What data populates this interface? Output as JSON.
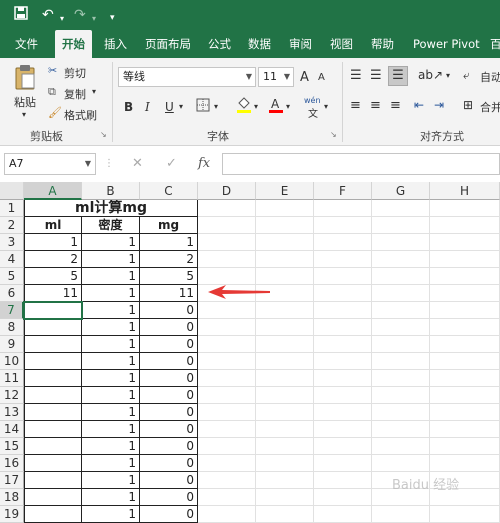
{
  "colors": {
    "brand": "#217346",
    "ribbon_bg": "#f3f3f3",
    "arrow": "#e53935",
    "font_color": "#ff0000",
    "fill_color": "#ffff00"
  },
  "quick_access": {
    "save_icon": "save-icon",
    "undo_icon": "undo-icon",
    "redo_icon": "redo-icon"
  },
  "tabs": [
    "文件",
    "开始",
    "插入",
    "页面布局",
    "公式",
    "数据",
    "审阅",
    "视图",
    "帮助",
    "Power Pivot",
    "百"
  ],
  "active_tab": "开始",
  "ribbon": {
    "clipboard": {
      "paste": "粘贴",
      "cut": "剪切",
      "copy": "复制",
      "format_painter": "格式刷",
      "group": "剪贴板"
    },
    "font": {
      "name": "等线",
      "size": "11",
      "bold": "B",
      "italic": "I",
      "underline": "U",
      "grow": "A",
      "shrink": "A",
      "group": "字体",
      "phonetic": "wén"
    },
    "alignment": {
      "wrap": "自动",
      "merge": "合并",
      "group": "对齐方式"
    }
  },
  "formula_bar": {
    "name_box": "A7",
    "cancel": "✕",
    "enter": "✓",
    "fx": "fx",
    "value": ""
  },
  "columns": [
    "A",
    "B",
    "C",
    "D",
    "E",
    "F",
    "G",
    "H"
  ],
  "rows": [
    "1",
    "2",
    "3",
    "4",
    "5",
    "6",
    "7",
    "8",
    "9",
    "10",
    "11",
    "12",
    "13",
    "14",
    "15",
    "16",
    "17",
    "18",
    "19"
  ],
  "table": {
    "title": "ml计算mg",
    "headers": [
      "ml",
      "密度",
      "mg"
    ],
    "data": [
      [
        "1",
        "1",
        "1"
      ],
      [
        "2",
        "1",
        "2"
      ],
      [
        "5",
        "1",
        "5"
      ],
      [
        "11",
        "1",
        "11"
      ],
      [
        "",
        "1",
        "0"
      ],
      [
        "",
        "1",
        "0"
      ],
      [
        "",
        "1",
        "0"
      ],
      [
        "",
        "1",
        "0"
      ],
      [
        "",
        "1",
        "0"
      ],
      [
        "",
        "1",
        "0"
      ],
      [
        "",
        "1",
        "0"
      ],
      [
        "",
        "1",
        "0"
      ],
      [
        "",
        "1",
        "0"
      ],
      [
        "",
        "1",
        "0"
      ],
      [
        "",
        "1",
        "0"
      ],
      [
        "",
        "1",
        "0"
      ],
      [
        "",
        "1",
        "0"
      ]
    ]
  },
  "selected_cell": "A7",
  "watermark": "Baidu 经验"
}
